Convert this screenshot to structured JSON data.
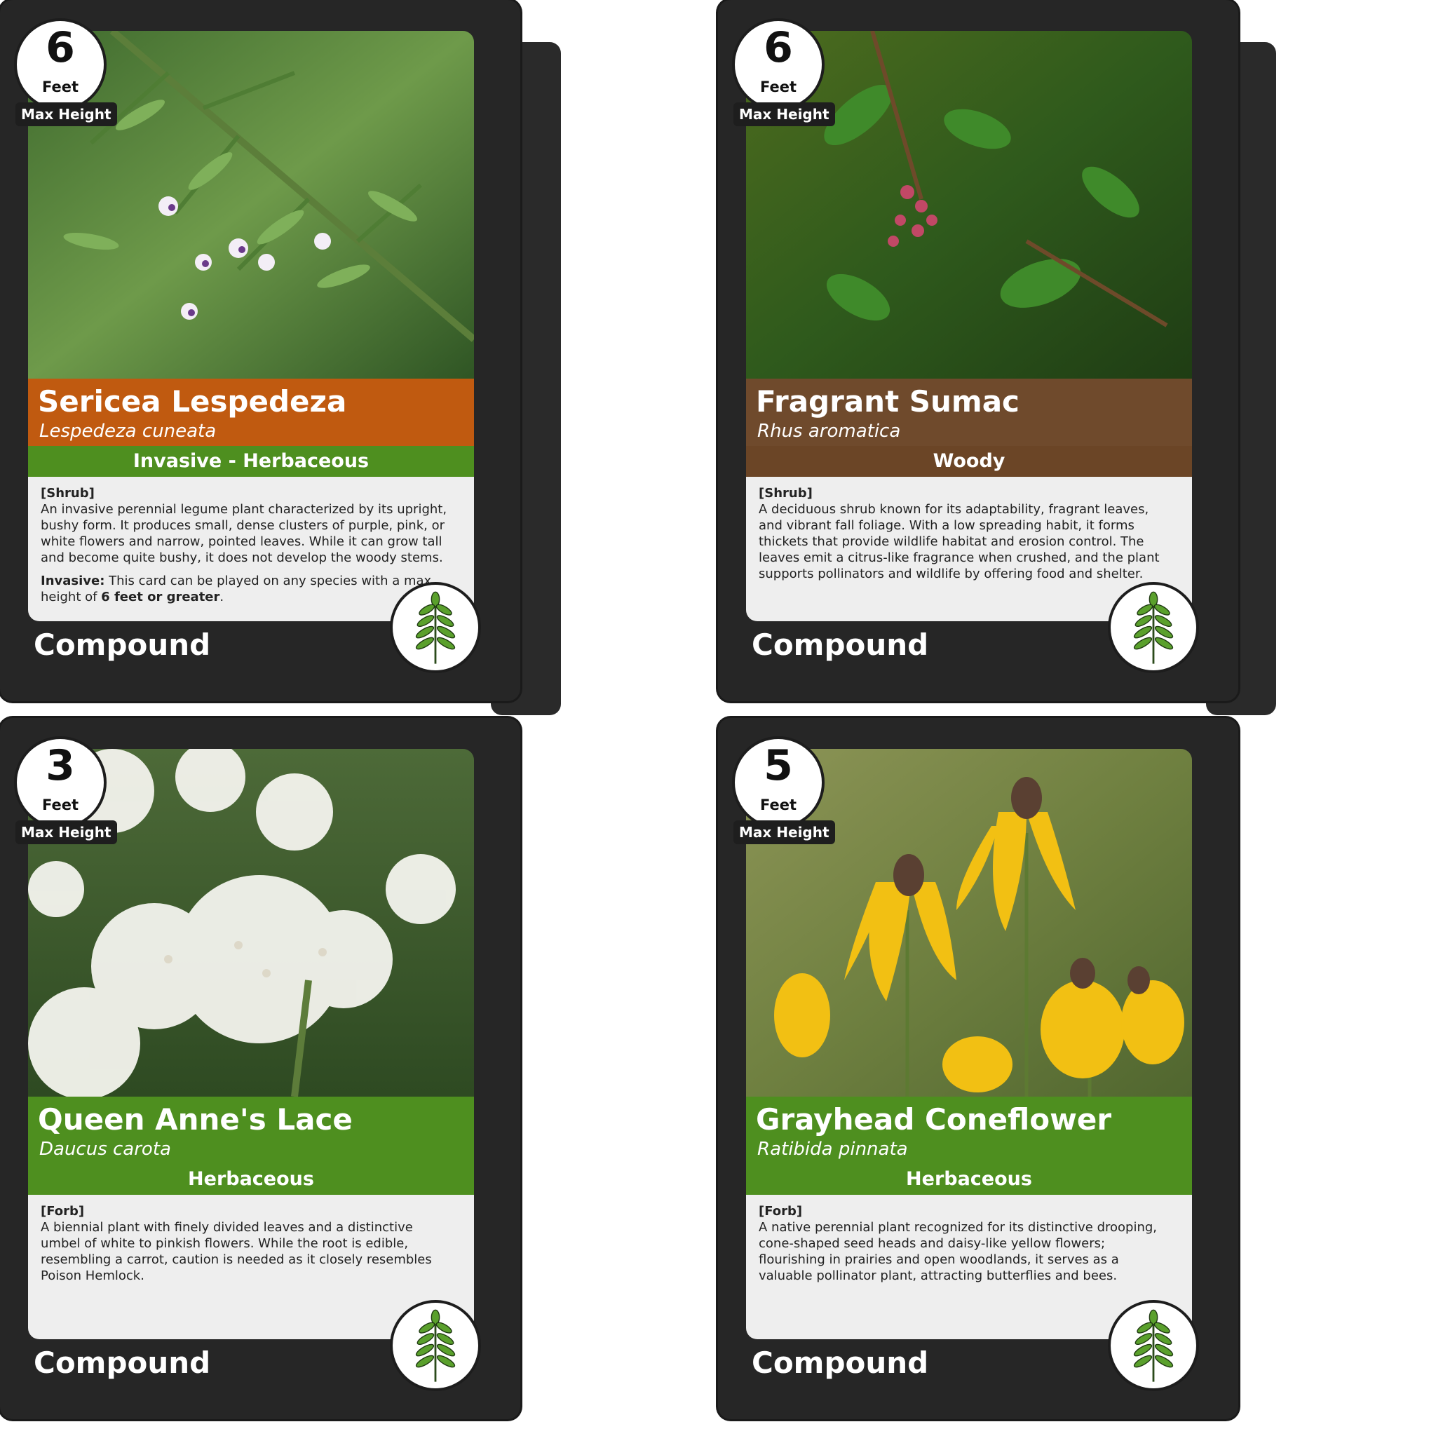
{
  "cards": [
    {
      "height_value": "6",
      "height_unit": "Feet",
      "height_label": "Max Height",
      "name": "Sericea Lespedeza",
      "scientific": "Lespedeza cuneata",
      "category": "Invasive - Herbaceous",
      "habit": "[Shrub]",
      "description": "An invasive perennial legume plant characterized by its upright, bushy form. It produces small, dense clusters of purple, pink, or white flowers and narrow, pointed leaves. While it can grow tall and become quite bushy, it does not develop the woody stems.",
      "note_label": "Invasive:",
      "note_text": " This card can be played on any species with a max height of ",
      "note_bold": "6 feet or greater",
      "note_end": ".",
      "leaf_type": "Compound",
      "leaf_icon": "compound-leaf-icon",
      "title_color": "#c05a10",
      "category_color": "#4e8f1f",
      "photo": "Sericea Lespedeza plant"
    },
    {
      "height_value": "6",
      "height_unit": "Feet",
      "height_label": "Max Height",
      "name": "Fragrant Sumac",
      "scientific": "Rhus aromatica",
      "category": "Woody",
      "habit": "[Shrub]",
      "description": "A deciduous shrub known for its adaptability, fragrant leaves, and vibrant fall foliage. With a low spreading habit, it forms thickets that provide wildlife habitat and erosion control. The leaves emit a citrus-like fragrance when crushed, and the plant supports pollinators and wildlife by offering food and shelter.",
      "leaf_type": "Compound",
      "leaf_icon": "compound-leaf-icon",
      "title_color": "#6f4a2c",
      "category_color": "#6b4526",
      "photo": "Fragrant Sumac shrub"
    },
    {
      "height_value": "3",
      "height_unit": "Feet",
      "height_label": "Max Height",
      "name": "Queen Anne's Lace",
      "scientific": "Daucus carota",
      "category": "Herbaceous",
      "habit": "[Forb]",
      "description": "A biennial plant with finely divided leaves and a distinctive umbel of white to pinkish flowers. While the root is edible, resembling a carrot, caution is needed as it closely resembles Poison Hemlock.",
      "leaf_type": "Compound",
      "leaf_icon": "compound-leaf-icon",
      "title_color": "#4e8f1f",
      "category_color": "#4e8f1f",
      "photo": "Queen Anne's Lace flowers"
    },
    {
      "height_value": "5",
      "height_unit": "Feet",
      "height_label": "Max Height",
      "name": "Grayhead Coneflower",
      "scientific": "Ratibida pinnata",
      "category": "Herbaceous",
      "habit": "[Forb]",
      "description": "A native perennial plant recognized for its distinctive drooping, cone-shaped seed heads and daisy-like yellow flowers; flourishing in prairies and open woodlands, it serves as a valuable pollinator plant, attracting butterflies and bees.",
      "leaf_type": "Compound",
      "leaf_icon": "compound-leaf-icon",
      "title_color": "#4e8f1f",
      "category_color": "#4e8f1f",
      "photo": "Grayhead Coneflower blooms"
    }
  ]
}
